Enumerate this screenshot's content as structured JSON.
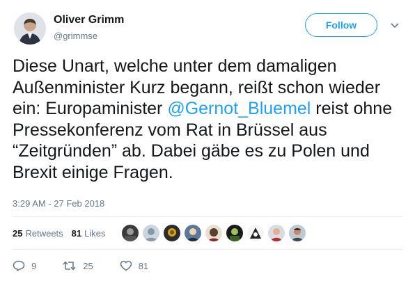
{
  "author": {
    "name": "Oliver Grimm",
    "handle": "@grimmse"
  },
  "follow_label": "Follow",
  "tweet": {
    "text_before": "Diese Unart, welche unter dem damaligen Außenminister Kurz begann, reißt schon wieder ein: Europaminister ",
    "mention": "@Gernot_Bluemel",
    "text_after": " reist ohne Pressekonferenz vom Rat in Brüssel aus “Zeitgründen” ab. Dabei gäbe es zu Polen und Brexit einige Fragen.",
    "timestamp": "3:29 AM - 27 Feb 2018"
  },
  "stats": {
    "retweets_count": "25",
    "retweets_label": "Retweets",
    "likes_count": "81",
    "likes_label": "Likes"
  },
  "liker_avatars": [
    "avatar-1",
    "avatar-2",
    "avatar-3",
    "avatar-4",
    "avatar-5",
    "avatar-6",
    "avatar-7",
    "avatar-8",
    "avatar-9"
  ],
  "actions": {
    "replies": "9",
    "retweets": "25",
    "likes": "81"
  },
  "colors": {
    "accent": "#1da1f2",
    "secondary_text": "#657786",
    "text": "#14171a"
  }
}
